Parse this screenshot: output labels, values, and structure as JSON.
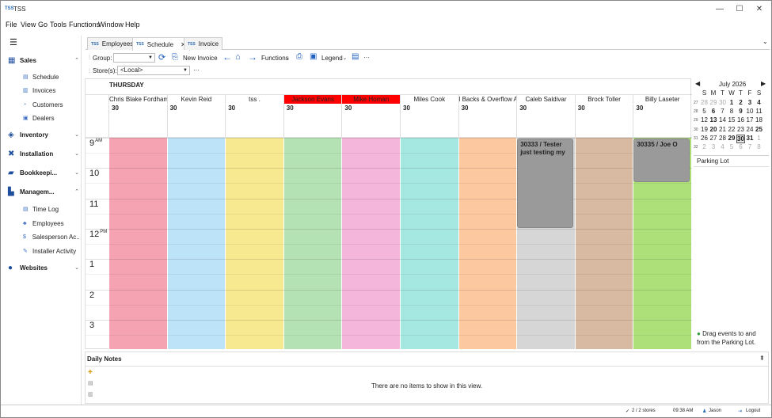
{
  "app": {
    "title": "TSS",
    "logo": "TSS"
  },
  "window_controls": {
    "minimize": "—",
    "maximize": "☐",
    "close": "✕"
  },
  "menu": [
    "File",
    "View",
    "Go",
    "Tools",
    "Functions",
    "Window",
    "Help"
  ],
  "sidebar": {
    "menu_icon": "☰",
    "groups": [
      {
        "label": "Sales",
        "icon": "store-icon",
        "chevron": "⌃",
        "items": [
          {
            "label": "Schedule",
            "icon": "calendar-icon"
          },
          {
            "label": "Invoices",
            "icon": "invoice-icon"
          },
          {
            "label": "Customers",
            "icon": "customers-icon"
          },
          {
            "label": "Dealers",
            "icon": "dealers-icon"
          }
        ]
      },
      {
        "label": "Inventory",
        "icon": "inventory-icon",
        "chevron": "⌄"
      },
      {
        "label": "Installation",
        "icon": "tools-icon",
        "chevron": "⌄"
      },
      {
        "label": "Bookkeepi...",
        "icon": "book-icon",
        "chevron": "⌄"
      },
      {
        "label": "Managem...",
        "icon": "chart-icon",
        "chevron": "⌃",
        "items": [
          {
            "label": "Time Log",
            "icon": "timelog-icon"
          },
          {
            "label": "Employees",
            "icon": "employees-icon"
          },
          {
            "label": "Salesperson Ac...",
            "icon": "dollar-icon"
          },
          {
            "label": "Installer Activity",
            "icon": "wrench-icon"
          }
        ]
      },
      {
        "label": "Websites",
        "icon": "globe-icon",
        "chevron": "⌄"
      }
    ]
  },
  "tabs": [
    {
      "label": "Employees",
      "logo": "TSS",
      "active": false
    },
    {
      "label": "Schedule",
      "logo": "TSS",
      "active": true,
      "close": "✕"
    },
    {
      "label": "Invoice",
      "logo": "TSS",
      "active": false
    }
  ],
  "tab_overflow": "⌄",
  "toolbar": {
    "group_label": "Group:",
    "group_value": "",
    "new_invoice": "New Invoice",
    "functions": "Functions",
    "legend": "Legend",
    "more": "···",
    "stores_label": "Store(s):",
    "stores_value": "<Local>",
    "stores_more": "···"
  },
  "schedule": {
    "day": "THURSDAY",
    "employees": [
      {
        "name": "Chris Blake Fordham",
        "date": "30",
        "color": "#f5a3b2"
      },
      {
        "name": "Kevin Reid",
        "date": "30",
        "color": "#bde3f8"
      },
      {
        "name": "tss .",
        "date": "30",
        "color": "#f7e98f"
      },
      {
        "name": "Jackson Evans",
        "date": "30",
        "color": "#b5e2b4",
        "header_color": "#ff0000"
      },
      {
        "name": "Mike Homan",
        "date": "30",
        "color": "#f4b6da",
        "header_color": "#ff0000"
      },
      {
        "name": "Miles Cook",
        "date": "30",
        "color": "#a5e8e2"
      },
      {
        "name": "l Backs & Overflow Ap",
        "date": "30",
        "color": "#fcc8a0"
      },
      {
        "name": "Caleb Saldivar",
        "date": "30",
        "color": "#d6d6d6"
      },
      {
        "name": "Brock Toller",
        "date": "30",
        "color": "#d8b9a1"
      },
      {
        "name": "Billy Laseter",
        "date": "30",
        "color": "#aee07a"
      }
    ],
    "hours": [
      {
        "h": "9",
        "ampm": "AM"
      },
      {
        "h": "10",
        "ampm": ""
      },
      {
        "h": "11",
        "ampm": ""
      },
      {
        "h": "12",
        "ampm": "PM"
      },
      {
        "h": "1",
        "ampm": ""
      },
      {
        "h": "2",
        "ampm": ""
      },
      {
        "h": "3",
        "ampm": ""
      }
    ],
    "events": [
      {
        "text": "30333 / Tester just testing my",
        "column": 7,
        "start_hour": 9.0,
        "end_hour": 12.0
      },
      {
        "text": "30335 / Joe O",
        "column": 9,
        "start_hour": 9.0,
        "end_hour": 10.5
      }
    ]
  },
  "calendar": {
    "month": "July 2026",
    "prev": "◀",
    "next": "▶",
    "weekdays": [
      "S",
      "M",
      "T",
      "W",
      "T",
      "F",
      "S"
    ],
    "weeks": [
      {
        "wk": "27",
        "days": [
          {
            "d": "28",
            "om": true
          },
          {
            "d": "29",
            "om": true
          },
          {
            "d": "30",
            "om": true
          },
          {
            "d": "1",
            "b": true
          },
          {
            "d": "2",
            "b": true
          },
          {
            "d": "3",
            "b": true
          },
          {
            "d": "4",
            "b": true
          }
        ]
      },
      {
        "wk": "28",
        "days": [
          {
            "d": "5"
          },
          {
            "d": "6",
            "b": true
          },
          {
            "d": "7"
          },
          {
            "d": "8"
          },
          {
            "d": "9",
            "b": true
          },
          {
            "d": "10"
          },
          {
            "d": "11"
          }
        ]
      },
      {
        "wk": "29",
        "days": [
          {
            "d": "12"
          },
          {
            "d": "13",
            "b": true
          },
          {
            "d": "14"
          },
          {
            "d": "15"
          },
          {
            "d": "16"
          },
          {
            "d": "17"
          },
          {
            "d": "18"
          }
        ]
      },
      {
        "wk": "30",
        "days": [
          {
            "d": "19"
          },
          {
            "d": "20",
            "b": true
          },
          {
            "d": "21"
          },
          {
            "d": "22"
          },
          {
            "d": "23"
          },
          {
            "d": "24"
          },
          {
            "d": "25",
            "b": true
          }
        ]
      },
      {
        "wk": "31",
        "days": [
          {
            "d": "26"
          },
          {
            "d": "27"
          },
          {
            "d": "28"
          },
          {
            "d": "29",
            "b": true
          },
          {
            "d": "30",
            "b": true,
            "sel": true
          },
          {
            "d": "31",
            "b": true
          },
          {
            "d": "1",
            "om": true
          }
        ]
      },
      {
        "wk": "32",
        "days": [
          {
            "d": "2",
            "om": true
          },
          {
            "d": "3",
            "om": true
          },
          {
            "d": "4",
            "om": true
          },
          {
            "d": "5",
            "om": true
          },
          {
            "d": "6",
            "om": true
          },
          {
            "d": "7",
            "om": true
          },
          {
            "d": "8",
            "om": true
          }
        ]
      }
    ]
  },
  "parking_lot": {
    "title": "Parking Lot",
    "hint": "Drag events to and from the Parking Lot."
  },
  "daily_notes": {
    "title": "Daily Notes",
    "pin": "⇞",
    "empty": "There are no items to show in this view."
  },
  "status": {
    "stores": "2 / 2 stores",
    "time": "09:38 AM",
    "user": "Jason",
    "logout": "Logout"
  }
}
